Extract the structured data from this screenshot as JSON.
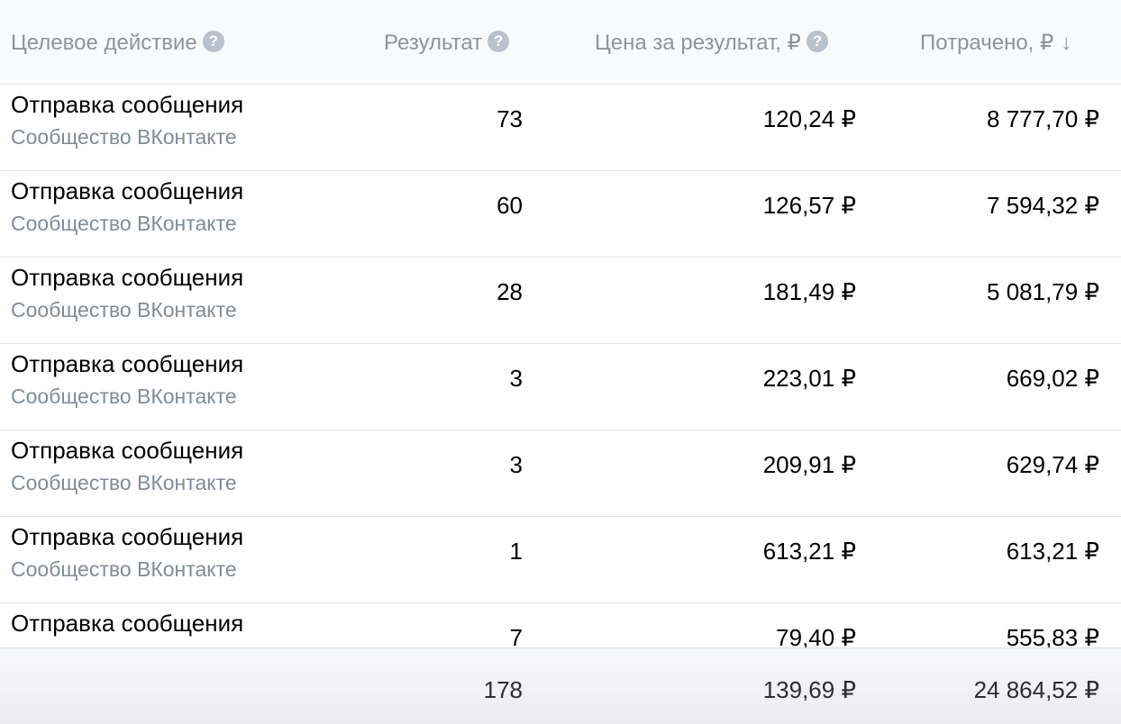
{
  "header": {
    "action": "Целевое действие",
    "result": "Результат",
    "price": "Цена за результат, ₽",
    "spent": "Потрачено, ₽",
    "help_glyph": "?",
    "sort_glyph": "↓",
    "help_icon": "question-circle-icon",
    "sort_icon": "arrow-down-icon"
  },
  "rows": [
    {
      "title": "Отправка сообщения",
      "subtitle": "Сообщество ВКонтакте",
      "result": "73",
      "price": "120,24 ₽",
      "spent": "8 777,70 ₽"
    },
    {
      "title": "Отправка сообщения",
      "subtitle": "Сообщество ВКонтакте",
      "result": "60",
      "price": "126,57 ₽",
      "spent": "7 594,32 ₽"
    },
    {
      "title": "Отправка сообщения",
      "subtitle": "Сообщество ВКонтакте",
      "result": "28",
      "price": "181,49 ₽",
      "spent": "5 081,79 ₽"
    },
    {
      "title": "Отправка сообщения",
      "subtitle": "Сообщество ВКонтакте",
      "result": "3",
      "price": "223,01 ₽",
      "spent": "669,02 ₽"
    },
    {
      "title": "Отправка сообщения",
      "subtitle": "Сообщество ВКонтакте",
      "result": "3",
      "price": "209,91 ₽",
      "spent": "629,74 ₽"
    },
    {
      "title": "Отправка сообщения",
      "subtitle": "Сообщество ВКонтакте",
      "result": "1",
      "price": "613,21 ₽",
      "spent": "613,21 ₽"
    },
    {
      "title": "Отправка сообщения",
      "subtitle": "",
      "result": "7",
      "price": "79,40 ₽",
      "spent": "555,83 ₽"
    }
  ],
  "totals": {
    "result": "178",
    "price": "139,69 ₽",
    "spent": "24 864,52 ₽"
  },
  "colors": {
    "header_bg": "#f9fafb",
    "header_text": "#909499",
    "help_icon": "#b8c1cc",
    "subtitle_text": "#818c99",
    "divider": "#e3e5e8"
  }
}
